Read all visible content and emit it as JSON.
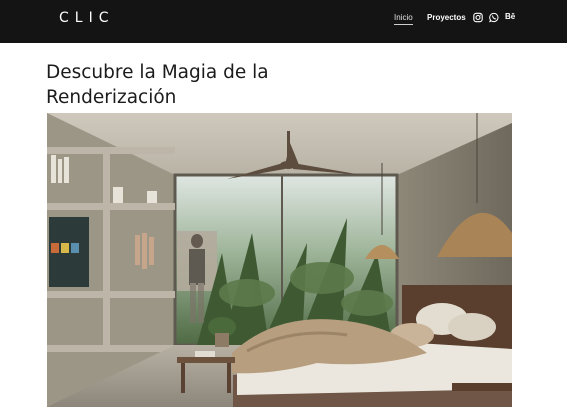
{
  "header": {
    "logo": "CLIC",
    "nav": [
      {
        "label": "Inicio",
        "active": true
      },
      {
        "label": "Proyectos",
        "active": false
      }
    ],
    "social": [
      {
        "icon": "instagram-icon"
      },
      {
        "icon": "whatsapp-icon"
      },
      {
        "label": "Bē"
      }
    ]
  },
  "main": {
    "title_line1": "Descubre la Magia de la",
    "title_line2": "Renderización",
    "hero_image": "bedroom-render-image"
  },
  "colors": {
    "header_bg": "#141414",
    "page_bg": "#ffffff",
    "text": "#1b1b1b"
  }
}
